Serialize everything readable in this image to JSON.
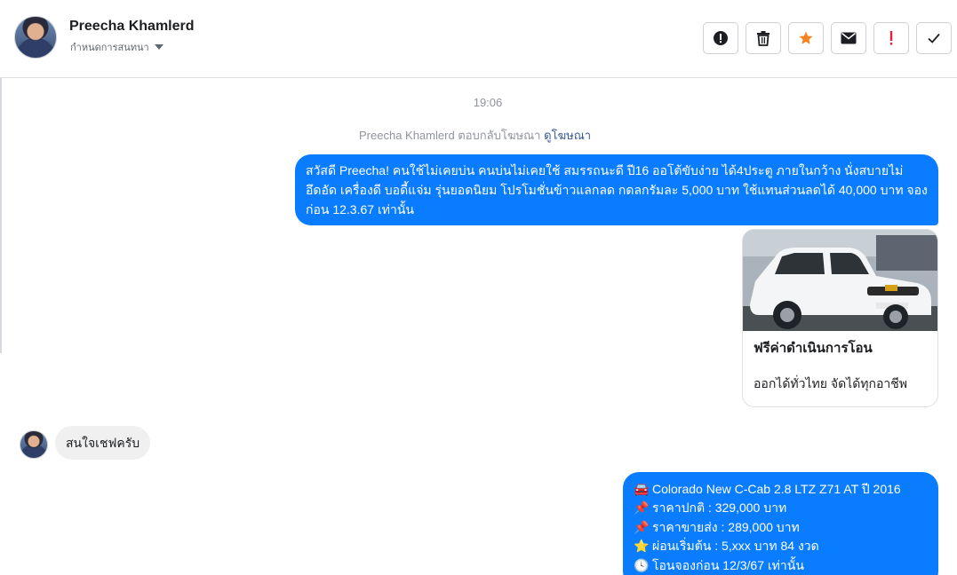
{
  "header": {
    "contact_name": "Preecha Khamlerd",
    "conversation_label": "กำหนดการสนทนา",
    "actions": [
      {
        "name": "report-icon"
      },
      {
        "name": "trash-icon"
      },
      {
        "name": "star-icon"
      },
      {
        "name": "mail-icon"
      },
      {
        "name": "important-icon"
      },
      {
        "name": "check-icon"
      }
    ]
  },
  "thread": {
    "timestamp": "19:06",
    "reply_note_text": "Preecha Khamlerd ตอบกลับโฆษณา",
    "reply_note_link": "ดูโฆษณา",
    "outgoing_message_1": "สวัสดี Preecha! คนใช้ไม่เคยบ่น คนบ่นไม่เคยใช้ สมรรถนะดี ปี16 ออโต้ขับง่าย ได้4ประตู ภายในกว้าง นั่งสบายไม่อึดอัด เครื่องดี บอดี้แจ่ม รุ่นยอดนิยม โปรโมชั่นข้าวแลกลด กดลกรัมละ 5,000 บาท ใช้แทนส่วนลดได้ 40,000 บาท จองก่อน 12.3.67 เท่านั้น",
    "ad_card": {
      "title": "ฟรีค่าดำเนินการโอน",
      "description": "ออกได้ทั่วไทย จัดได้ทุกอาชีพ"
    },
    "incoming_message": "สนใจเชฟครับ",
    "outgoing_message_2": {
      "lines": [
        {
          "icon": "car-icon",
          "glyph": "🚘",
          "text": "Colorado New C-Cab 2.8 LTZ Z71 AT ปี 2016"
        },
        {
          "icon": "pin-icon",
          "glyph": "📌",
          "text": "ราคาปกติ : 329,000 บาท"
        },
        {
          "icon": "pin-icon",
          "glyph": "📌",
          "text": "ราคาขายส่ง : 289,000 บาท"
        },
        {
          "icon": "star-icon",
          "glyph": "⭐",
          "text": "ผ่อนเริ่มต้น : 5,xxx บาท 84 งวด"
        },
        {
          "icon": "clock-icon",
          "glyph": "🕓",
          "text": "โอนจองก่อน 12/3/67 เท่านั้น"
        }
      ]
    }
  },
  "colors": {
    "outgoing_bubble": "#0a7cff",
    "incoming_bubble": "#f0f0f0",
    "star_accent": "#f5821f",
    "important_accent": "#e41e3f"
  }
}
